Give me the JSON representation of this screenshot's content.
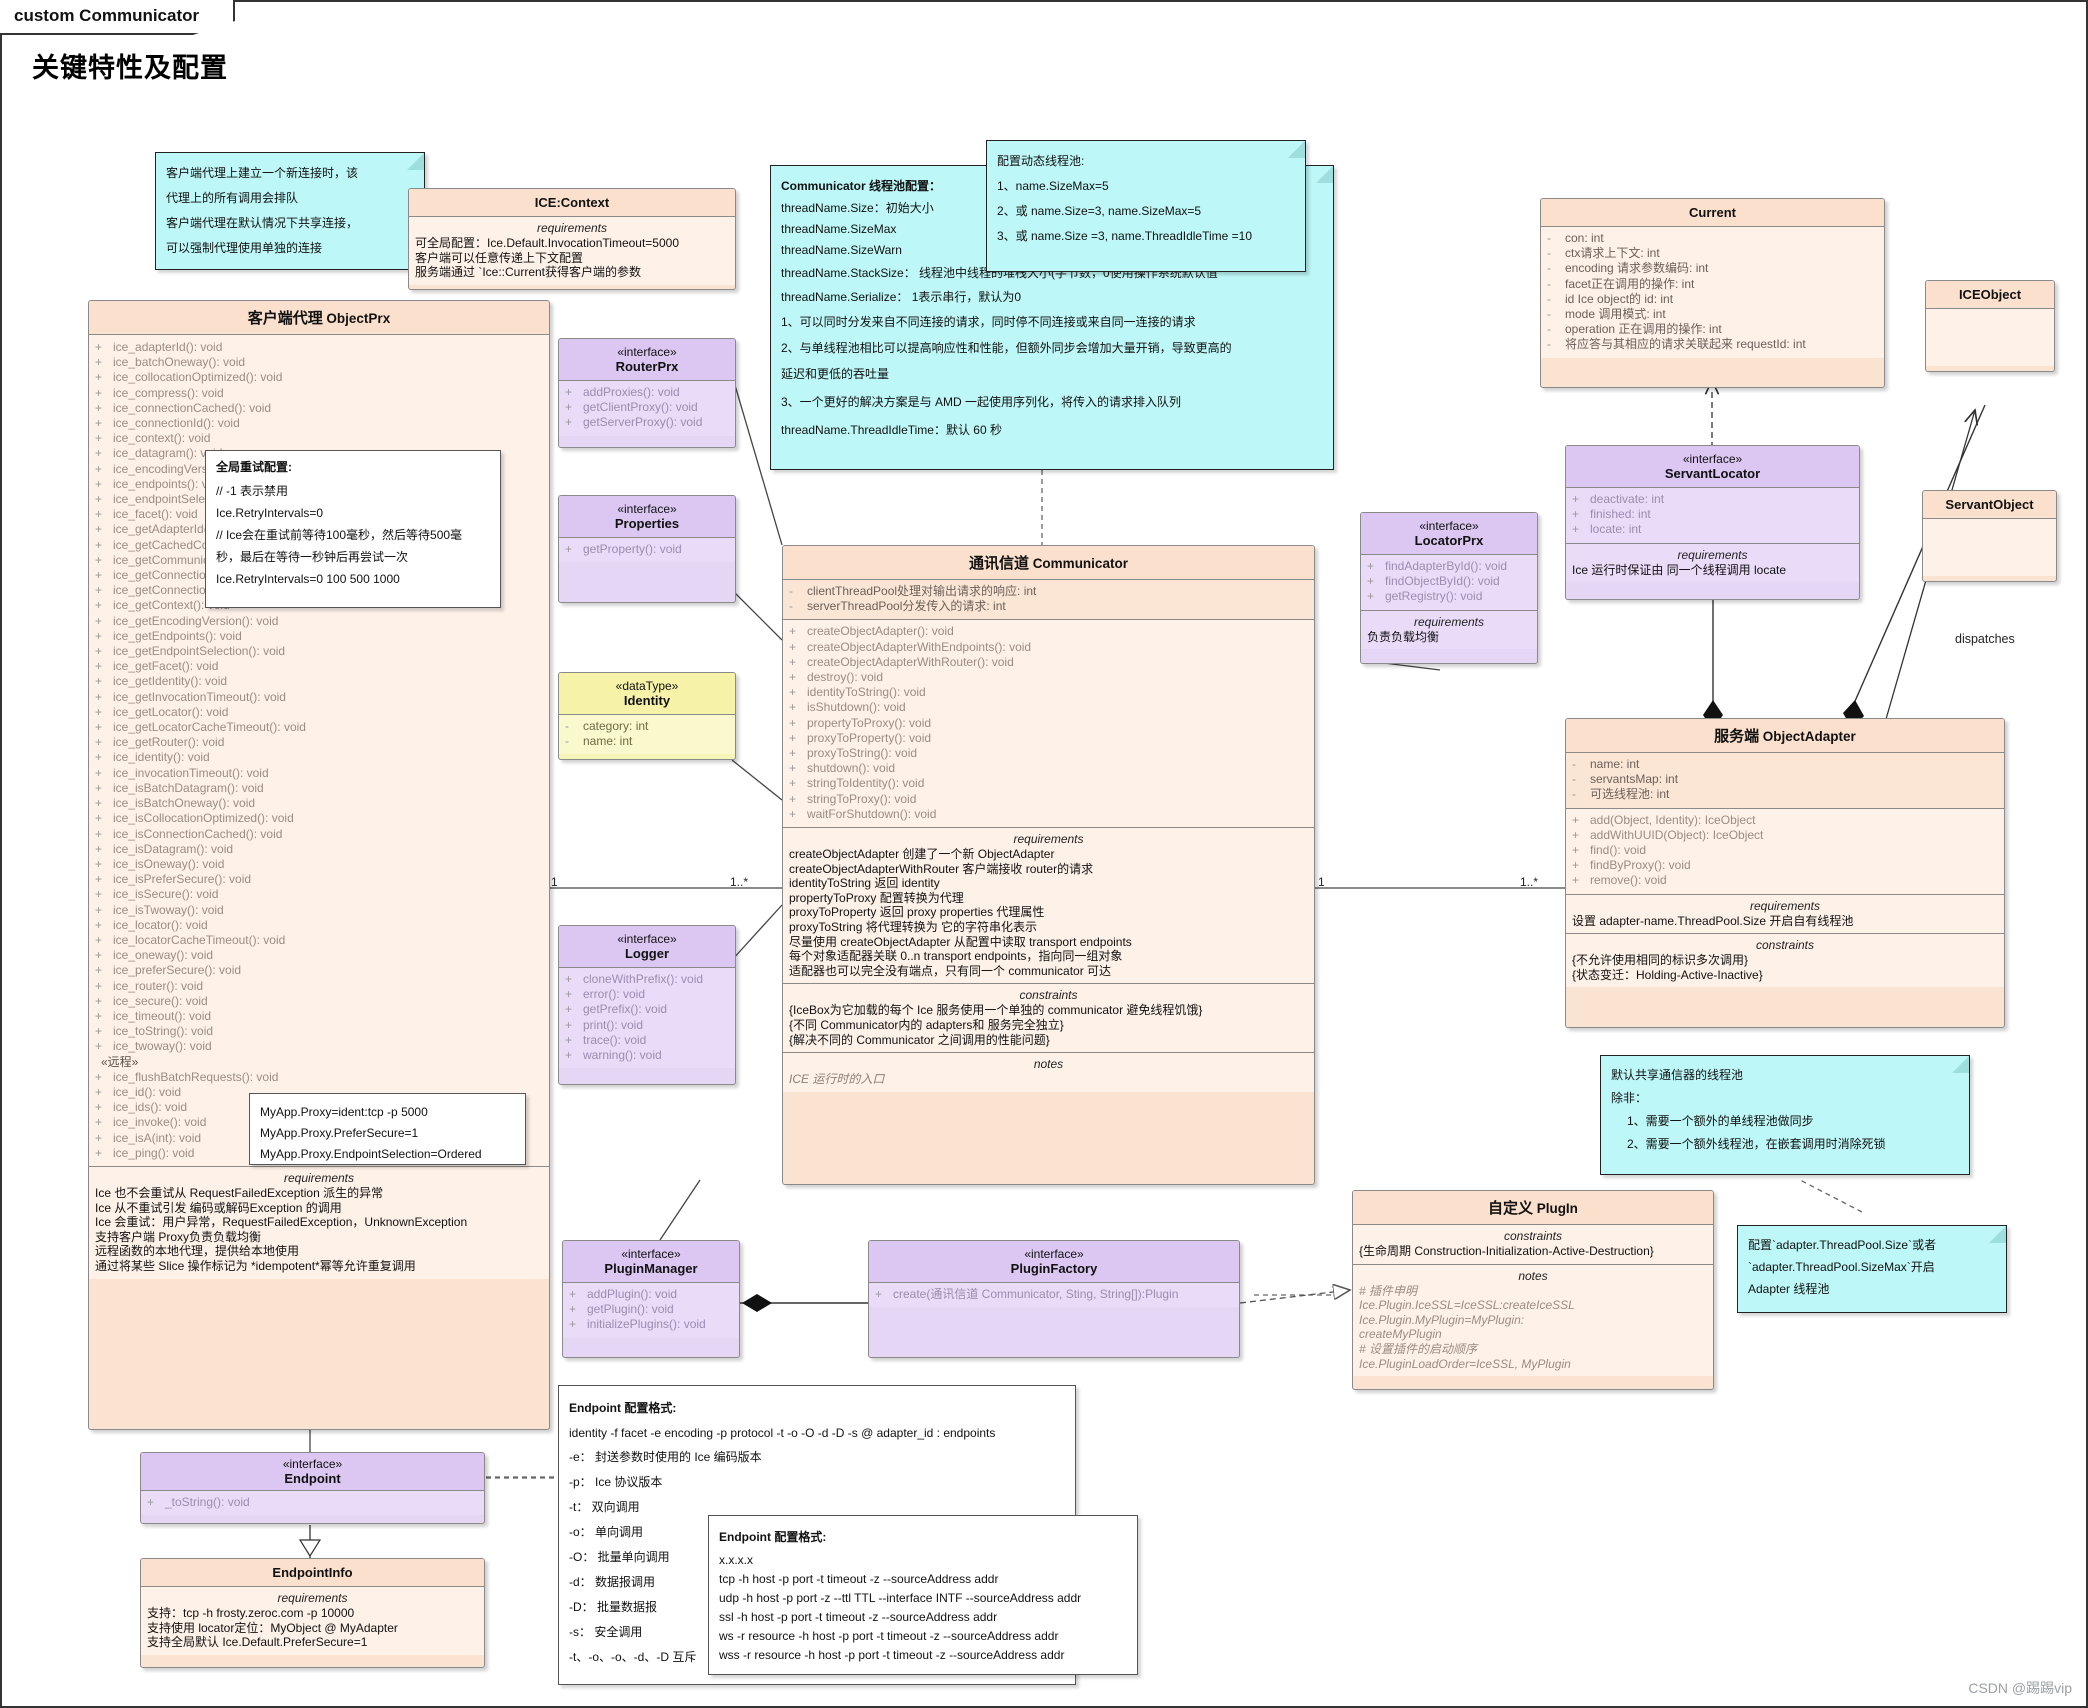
{
  "frame": {
    "tab_label": "custom Communicator"
  },
  "page": {
    "title": "关键特性及配置",
    "watermark": "CSDN @踢踢vip"
  },
  "notes": {
    "client_proxy": {
      "lines": [
        "客户端代理上建立一个新连接时，该",
        "代理上的所有调用会排队",
        "客户端代理在默认情况下共享连接，",
        "可以强制代理使用单独的连接"
      ]
    },
    "retry_config": {
      "title": "全局重试配置:",
      "lines": [
        "// -1 表示禁用",
        "Ice.RetryIntervals=0",
        "// Ice会在重试前等待100毫秒，然后等待500毫",
        "秒，最后在等待一秒钟后再尝试一次",
        "Ice.RetryIntervals=0 100 500 1000"
      ]
    },
    "proxy_props": {
      "lines": [
        "MyApp.Proxy=ident:tcp -p 5000",
        "MyApp.Proxy.PreferSecure=1",
        "MyApp.Proxy.EndpointSelection=Ordered"
      ]
    },
    "threadpool_dynamic": {
      "lines": [
        "配置动态线程池:",
        "1、name.SizeMax=5",
        "2、或 name.Size=3, name.SizeMax=5",
        "3、或 name.Size =3, name.ThreadIdleTime =10"
      ]
    },
    "communicator_threadpool": {
      "title": "Communicator 线程池配置：",
      "lines": [
        "threadName.Size：初始大小",
        "threadName.SizeMax",
        "threadName.SizeWarn",
        "threadName.StackSize：  线程池中线程的堆栈大小(字节数，0使用操作系统默认值",
        "threadName.Serialize：  1表示串行，默认为0",
        "1、可以同时分发来自不同连接的请求，同时停不同连接或来自同一连接的请求",
        "2、与单线程池相比可以提高响应性和性能，但额外同步会增加大量开销，导致更高的",
        "延迟和更低的吞吐量",
        "3、一个更好的解决方案是与 AMD 一起使用序列化，将传入的请求排入队列",
        "threadName.ThreadIdleTime：默认 60 秒"
      ]
    },
    "shared_threadpool": {
      "lines": [
        "默认共享通信器的线程池",
        "除非：",
        "1、需要一个额外的单线程池做同步",
        "2、需要一个额外线程池，在嵌套调用时消除死锁"
      ]
    },
    "adapter_threadpool": {
      "lines": [
        "配置`adapter.ThreadPool.Size`或者",
        "`adapter.ThreadPool.SizeMax`开启",
        "Adapter 线程池"
      ]
    },
    "endpoint_format": {
      "title": "Endpoint 配置格式:",
      "lines": [
        "identity -f facet -e encoding -p protocol -t -o -O -d -D -s @ adapter_id : endpoints",
        "-e：  封送参数时使用的 Ice 编码版本",
        "-p：  Ice 协议版本",
        "-t：  双向调用",
        "-o：  单向调用",
        "-O：  批量单向调用",
        "-d：  数据报调用",
        "-D：  批量数据报",
        "-s：  安全调用",
        "-t、-o、-o、-d、-D 互斥"
      ]
    },
    "endpoint_format2": {
      "title": "Endpoint 配置格式:",
      "lines": [
        "x.x.x.x",
        "tcp -h host -p port -t timeout -z --sourceAddress addr",
        "udp -h host -p port -z --ttl TTL --interface INTF --sourceAddress addr",
        "ssl -h host -p port -t timeout -z --sourceAddress addr",
        "ws -r resource -h host -p port -t timeout -z --sourceAddress addr",
        "wss -r resource -h host -p port -t timeout -z --sourceAddress addr"
      ]
    }
  },
  "classes": {
    "ice_context": {
      "title": "ICE:Context",
      "requirements_label": "requirements",
      "requirements": [
        "可全局配置：Ice.Default.InvocationTimeout=5000",
        "客户端可以任意传递上下文配置",
        "服务端通过 `Ice::Current获得客户端的参数"
      ]
    },
    "object_prx": {
      "title_cn": "客户端代理",
      "title_en": "ObjectPrx",
      "methods": [
        "ice_adapterId(): void",
        "ice_batchOneway(): void",
        "ice_collocationOptimized(): void",
        "ice_compress(): void",
        "ice_connectionCached(): void",
        "ice_connectionId(): void",
        "ice_context(): void",
        "ice_datagram(): void",
        "ice_encodingVersion(): void",
        "ice_endpoints(): void",
        "ice_endpointSelection(): void",
        "ice_facet(): void",
        "ice_getAdapterId(): void",
        "ice_getCachedConnection(): void",
        "ice_getCommunicator(): void",
        "ice_getConnection(): void",
        "ice_getConnectionId(): void",
        "ice_getContext(): void",
        "ice_getEncodingVersion(): void",
        "ice_getEndpoints(): void",
        "ice_getEndpointSelection(): void",
        "ice_getFacet(): void",
        "ice_getIdentity(): void",
        "ice_getInvocationTimeout(): void",
        "ice_getLocator(): void",
        "ice_getLocatorCacheTimeout(): void",
        "ice_getRouter(): void",
        "ice_identity(): void",
        "ice_invocationTimeout(): void",
        "ice_isBatchDatagram(): void",
        "ice_isBatchOneway(): void",
        "ice_isCollocationOptimized(): void",
        "ice_isConnectionCached(): void",
        "ice_isDatagram(): void",
        "ice_isOneway(): void",
        "ice_isPreferSecure(): void",
        "ice_isSecure(): void",
        "ice_isTwoway(): void",
        "ice_locator(): void",
        "ice_locatorCacheTimeout(): void",
        "ice_oneway(): void",
        "ice_preferSecure(): void",
        "ice_router(): void",
        "ice_secure(): void",
        "ice_timeout(): void",
        "ice_toString(): void",
        "ice_twoway(): void"
      ],
      "remote_stereo": "«远程»",
      "remote_methods": [
        "ice_flushBatchRequests(): void",
        "ice_id(): void",
        "ice_ids(): void",
        "ice_invoke(): void",
        "ice_isA(int): void",
        "ice_ping(): void"
      ],
      "requirements_label": "requirements",
      "requirements": [
        "Ice 也不会重试从 RequestFailedException 派生的异常",
        "Ice 从不重试引发 编码或解码Exception 的调用",
        "Ice 会重试：用户异常，RequestFailedException，UnknownException",
        "支持客户端 Proxy负责负载均衡",
        "远程函数的本地代理，提供给本地使用",
        "通过将某些 Slice 操作标记为 *idempotent*幂等允许重复调用"
      ]
    },
    "router_prx": {
      "stereotype": "«interface»",
      "title": "RouterPrx",
      "methods": [
        "addProxies(): void",
        "getClientProxy(): void",
        "getServerProxy(): void"
      ]
    },
    "properties": {
      "stereotype": "«interface»",
      "title": "Properties",
      "methods": [
        "getProperty(): void"
      ]
    },
    "identity": {
      "stereotype": "«dataType»",
      "title": "Identity",
      "attributes": [
        "category: int",
        "name: int"
      ]
    },
    "logger": {
      "stereotype": "«interface»",
      "title": "Logger",
      "methods": [
        "cloneWithPrefix(): void",
        "error(): void",
        "getPrefix(): void",
        "print(): void",
        "trace(): void",
        "warning(): void"
      ]
    },
    "communicator": {
      "title_cn": "通讯信道",
      "title_en": "Communicator",
      "attributes": [
        "clientThreadPool处理对输出请求的响应: int",
        "serverThreadPool分发传入的请求: int"
      ],
      "methods": [
        "createObjectAdapter(): void",
        "createObjectAdapterWithEndpoints(): void",
        "createObjectAdapterWithRouter(): void",
        "destroy(): void",
        "identityToString(): void",
        "isShutdown(): void",
        "propertyToProxy(): void",
        "proxyToProperty(): void",
        "proxyToString(): void",
        "shutdown(): void",
        "stringToIdentity(): void",
        "stringToProxy(): void",
        "waitForShutdown(): void"
      ],
      "requirements_label": "requirements",
      "requirements": [
        "createObjectAdapter 创建了一个新 ObjectAdapter",
        "createObjectAdapterWithRouter 客户端接收 router的请求",
        "identityToString 返回 identity",
        "propertyToProxy 配置转换为代理",
        "proxyToProperty 返回 proxy properties 代理属性",
        "proxyToString 将代理转换为 它的字符串化表示",
        "尽量使用 createObjectAdapter 从配置中读取 transport endpoints",
        "每个对象适配器关联 0..n transport endpoints，指向同一组对象",
        "适配器也可以完全没有端点，只有同一个 communicator 可达"
      ],
      "constraints_label": "constraints",
      "constraints": [
        "{IceBox为它加载的每个 Ice 服务使用一个单独的 communicator 避免线程饥饿}",
        "{不同 Communicator内的 adapters和 服务完全独立}",
        "{解决不同的 Communicator 之间调用的性能问题}"
      ],
      "notes_label": "notes",
      "notes": [
        "ICE 运行时的入口"
      ]
    },
    "locator_prx": {
      "stereotype": "«interface»",
      "title": "LocatorPrx",
      "methods": [
        "findAdapterById(): void",
        "findObjectById(): void",
        "getRegistry(): void"
      ],
      "requirements_label": "requirements",
      "requirements": [
        "负责负载均衡"
      ]
    },
    "current": {
      "title": "Current",
      "attributes": [
        "con: int",
        "ctx请求上下文: int",
        "encoding 请求参数编码: int",
        "facet正在调用的操作: int",
        "id Ice object的 id: int",
        "mode 调用模式: int",
        "operation 正在调用的操作: int",
        "将应答与其相应的请求关联起来 requestId: int"
      ]
    },
    "ice_object": {
      "title": "ICEObject"
    },
    "servant_locator": {
      "stereotype": "«interface»",
      "title": "ServantLocator",
      "methods": [
        "deactivate: int",
        "finished: int",
        "locate: int"
      ],
      "requirements_label": "requirements",
      "requirements": [
        "Ice 运行时保证由 同一个线程调用 locate"
      ]
    },
    "servant_object": {
      "title": "ServantObject"
    },
    "object_adapter": {
      "title_cn": "服务端",
      "title_en": "ObjectAdapter",
      "attributes": [
        "name: int",
        "servantsMap: int",
        "可选线程池: int"
      ],
      "methods": [
        "add(Object, Identity): IceObject",
        "addWithUUID(Object): IceObject",
        "find(): void",
        "findByProxy(): void",
        "remove(): void"
      ],
      "requirements_label": "requirements",
      "requirements": [
        "设置 adapter-name.ThreadPool.Size 开启自有线程池"
      ],
      "constraints_label": "constraints",
      "constraints": [
        "{不允许使用相同的标识多次调用}",
        "{状态变迁：Holding-Active-Inactive}"
      ]
    },
    "plugin_manager": {
      "stereotype": "«interface»",
      "title": "PluginManager",
      "methods": [
        "addPlugin(): void",
        "getPlugin(): void",
        "initializePlugins(): void"
      ]
    },
    "plugin_factory": {
      "stereotype": "«interface»",
      "title": "PluginFactory",
      "methods": [
        "create(通讯信道 Communicator, Sting, String[]):Plugin"
      ]
    },
    "custom_plugin": {
      "title_cn": "自定义",
      "title_en": "PlugIn",
      "constraints_label": "constraints",
      "constraints": [
        "{生命周期 Construction-Initialization-Active-Destruction}"
      ],
      "notes_label": "notes",
      "notes": [
        "# 插件申明",
        "Ice.Plugin.IceSSL=IceSSL:createIceSSL",
        "Ice.Plugin.MyPlugin=MyPlugin:",
        "createMyPlugin",
        "# 设置插件的启动顺序",
        "Ice.PluginLoadOrder=IceSSL, MyPlugin"
      ]
    },
    "endpoint": {
      "stereotype": "«interface»",
      "title": "Endpoint",
      "methods": [
        "_toString(): void"
      ]
    },
    "endpoint_info": {
      "title": "EndpointInfo",
      "requirements_label": "requirements",
      "requirements": [
        "支持：tcp -h frosty.zeroc.com -p 10000",
        "支持使用 locator定位：MyObject @ MyAdapter",
        "支持全局默认 Ice.Default.PreferSecure=1"
      ]
    }
  },
  "multiplicities": {
    "prx_one": "1",
    "comm_many": "1..*",
    "comm_one": "1",
    "adapter_many": "1..*"
  },
  "edges": {
    "dispatches": "dispatches"
  }
}
